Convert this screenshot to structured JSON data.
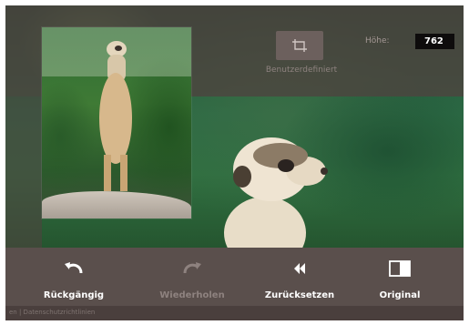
{
  "crop_panel": {
    "preset_label": "Benutzerdefiniert",
    "height_label": "Höhe:",
    "height_value": "762"
  },
  "toolbar": {
    "undo_label": "Rückgängig",
    "redo_label": "Wiederholen",
    "reset_label": "Zurücksetzen",
    "original_label": "Original"
  },
  "footer": {
    "text": "en  |  Datenschutzrichtlinien"
  },
  "colors": {
    "panel": "#4a3f3d",
    "toolbar": "#5a4f4c",
    "active_text": "#ffffff",
    "disabled_text": "#8e827f"
  }
}
